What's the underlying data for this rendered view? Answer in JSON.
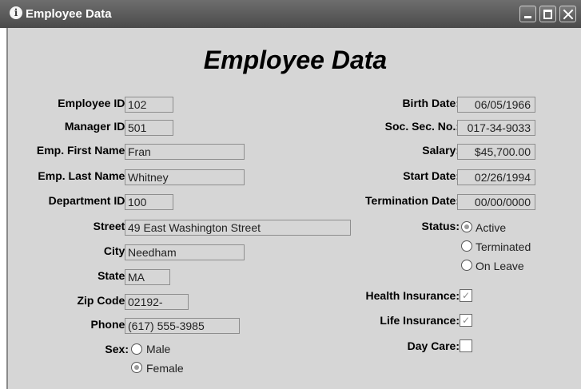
{
  "window": {
    "title": "Employee Data",
    "title_icon": "info-icon"
  },
  "heading": "Employee Data",
  "left_fields": {
    "employee_id": {
      "label": "Employee ID:",
      "value": "102"
    },
    "manager_id": {
      "label": "Manager ID:",
      "value": "501"
    },
    "first_name": {
      "label": "Emp. First Name:",
      "value": "Fran"
    },
    "last_name": {
      "label": "Emp. Last Name:",
      "value": "Whitney"
    },
    "department_id": {
      "label": "Department ID:",
      "value": "100"
    },
    "street": {
      "label": "Street:",
      "value": "49 East Washington Street"
    },
    "city": {
      "label": "City:",
      "value": "Needham"
    },
    "state": {
      "label": "State:",
      "value": "MA"
    },
    "zip": {
      "label": "Zip Code:",
      "value": "02192-"
    },
    "phone": {
      "label": "Phone:",
      "value": "(617) 555-3985"
    }
  },
  "sex": {
    "label": "Sex:",
    "options": [
      "Male",
      "Female"
    ],
    "selected": "Female"
  },
  "right_fields": {
    "birth_date": {
      "label": "Birth Date:",
      "value": "06/05/1966"
    },
    "ssn": {
      "label": "Soc. Sec. No.:",
      "value": "017-34-9033"
    },
    "salary": {
      "label": "Salary:",
      "value": "$45,700.00"
    },
    "start_date": {
      "label": "Start Date:",
      "value": "02/26/1994"
    },
    "termination_date": {
      "label": "Termination Date:",
      "value": "00/00/0000"
    }
  },
  "status": {
    "label": "Status:",
    "options": [
      "Active",
      "Terminated",
      "On Leave"
    ],
    "selected": "Active"
  },
  "benefits": {
    "health": {
      "label": "Health Insurance:",
      "checked": true
    },
    "life": {
      "label": "Life Insurance:",
      "checked": true
    },
    "day_care": {
      "label": "Day Care:",
      "checked": false
    }
  }
}
